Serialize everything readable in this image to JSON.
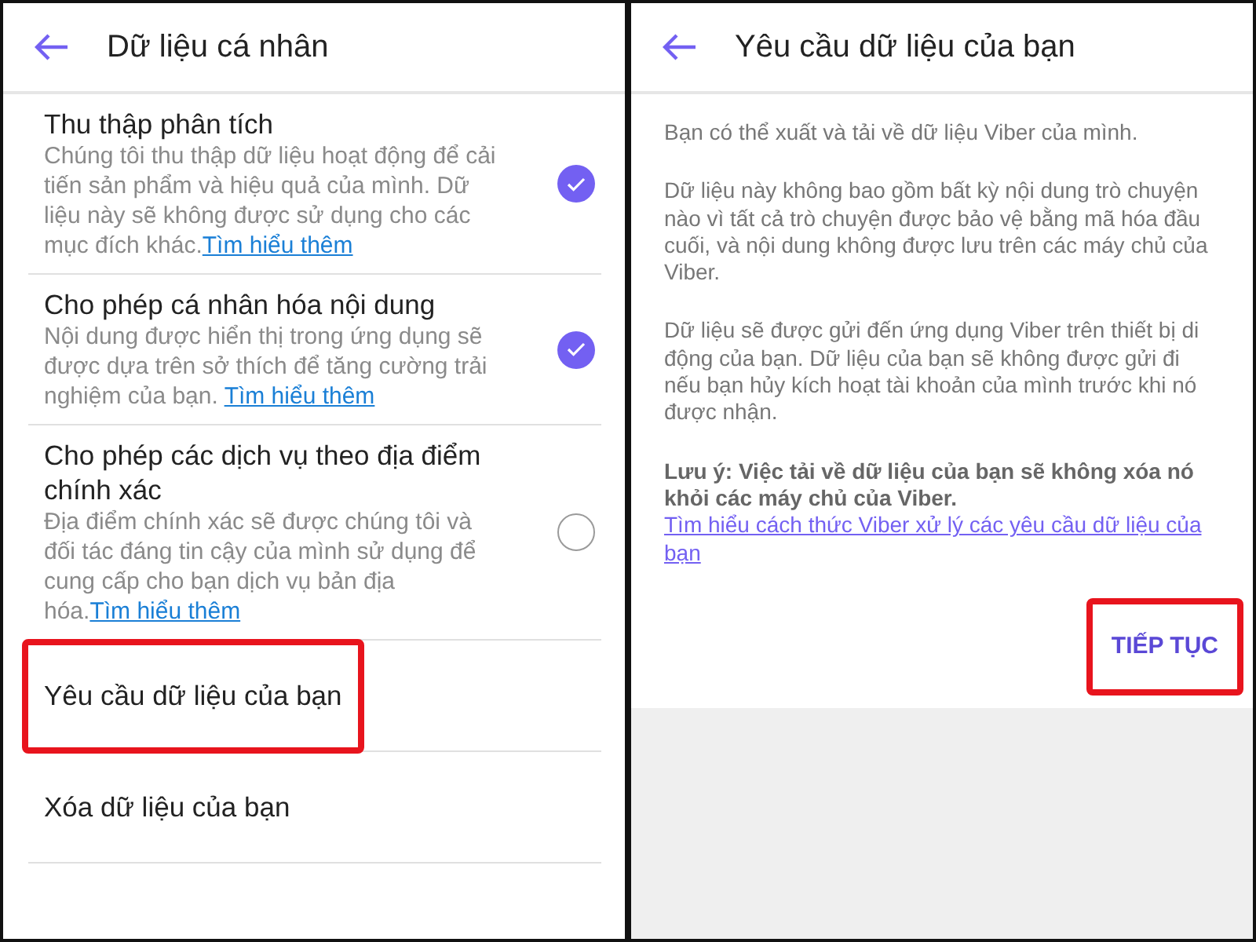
{
  "left_screen": {
    "title": "Dữ liệu cá nhân",
    "items": [
      {
        "kind": "toggle",
        "title": "Thu thập phân tích",
        "description": "Chúng tôi thu thập dữ liệu hoạt động để cải tiến sản phẩm và hiệu quả của mình. Dữ liệu này sẽ không được sử dụng cho các mục đích khác.",
        "link": "Tìm hiểu thêm",
        "checked": true
      },
      {
        "kind": "toggle",
        "title": "Cho phép cá nhân hóa nội dung",
        "description": "Nội dung được hiển thị trong ứng dụng sẽ được dựa trên sở thích để tăng cường trải nghiệm của bạn. ",
        "link": "Tìm hiểu thêm",
        "checked": true
      },
      {
        "kind": "toggle",
        "title": "Cho phép các dịch vụ theo địa điểm chính xác",
        "description": "Địa điểm chính xác sẽ được chúng tôi và đối tác đáng tin cậy của mình sử dụng để cung cấp cho bạn dịch vụ bản địa hóa.",
        "link": "Tìm hiểu thêm",
        "checked": false
      },
      {
        "kind": "action",
        "title": "Yêu cầu dữ liệu của bạn",
        "highlighted": true
      },
      {
        "kind": "action",
        "title": "Xóa dữ liệu của bạn",
        "highlighted": false
      }
    ]
  },
  "right_screen": {
    "title": "Yêu cầu dữ liệu của bạn",
    "paragraphs": [
      {
        "text": "Bạn có thể xuất và tải về dữ liệu Viber của mình."
      },
      {
        "text": "Dữ liệu này không bao gồm bất kỳ nội dung trò chuyện nào vì tất cả trò chuyện được bảo vệ bằng mã hóa đầu cuối, và nội dung không được lưu trên các máy chủ của Viber."
      },
      {
        "text": "Dữ liệu sẽ được gửi đến ứng dụng Viber trên thiết bị di động của bạn. Dữ liệu của bạn sẽ không được gửi đi nếu bạn hủy kích hoạt tài khoản của mình trước khi nó được nhận."
      },
      {
        "text": "**Lưu ý: Việc tải về dữ liệu của bạn sẽ không xóa nó khỏi các máy chủ của Viber.**",
        "link": "Tìm hiểu cách thức Viber xử lý các yêu cầu dữ liệu của bạn"
      }
    ],
    "button": {
      "label": "TIẾP TỤC",
      "highlighted": true
    }
  }
}
